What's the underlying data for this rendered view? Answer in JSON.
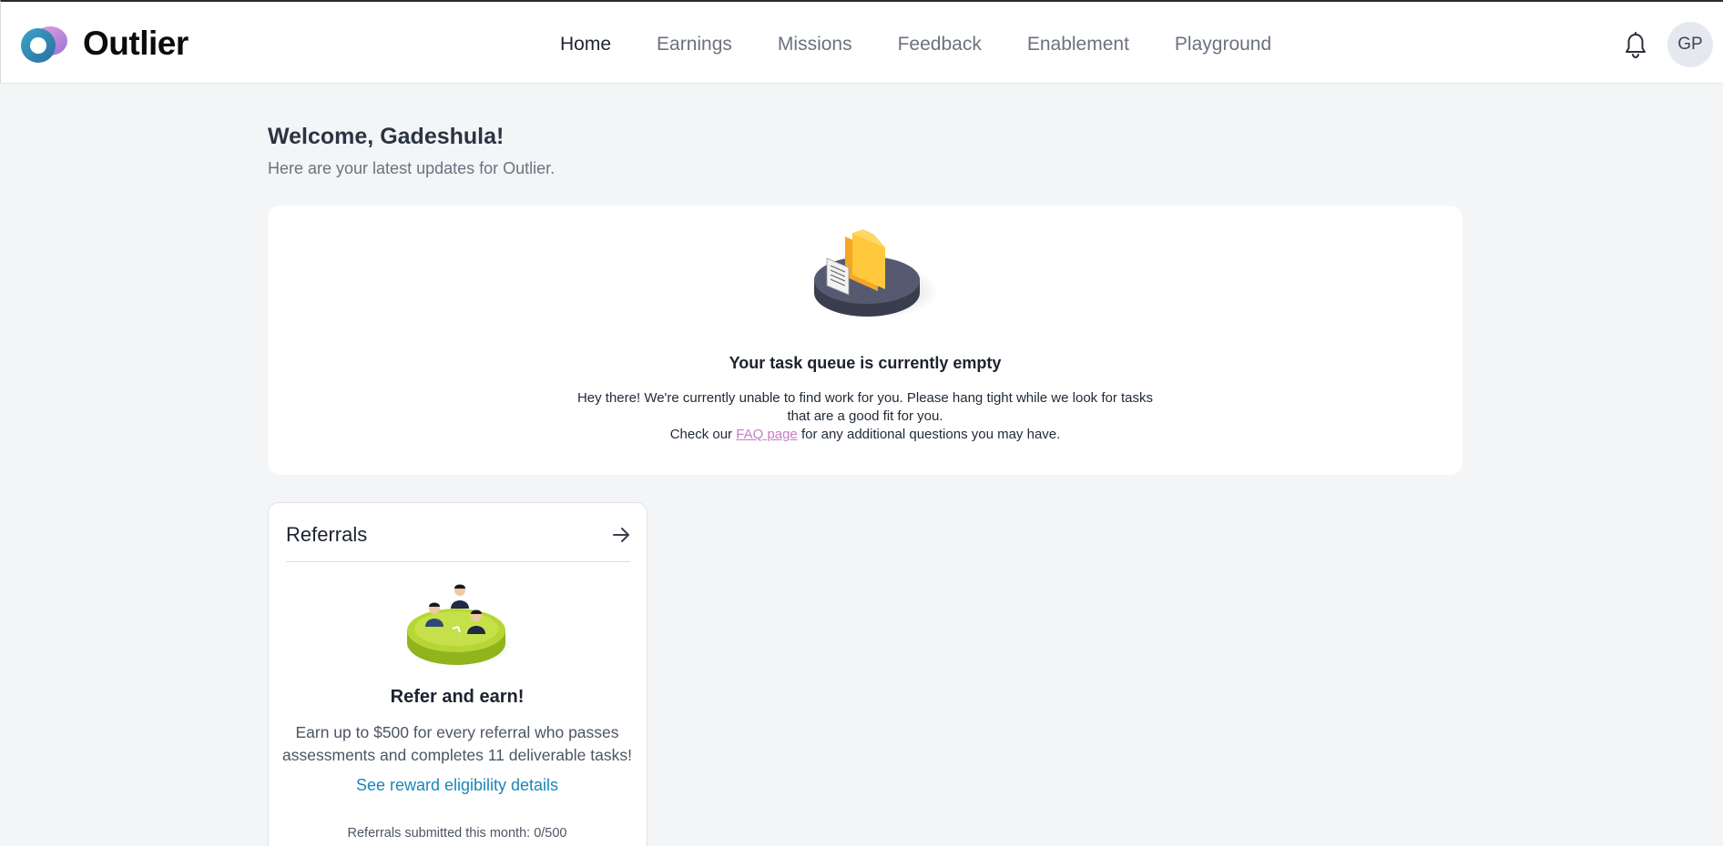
{
  "header": {
    "brand": "Outlier",
    "nav": [
      {
        "label": "Home",
        "active": true
      },
      {
        "label": "Earnings",
        "active": false
      },
      {
        "label": "Missions",
        "active": false
      },
      {
        "label": "Feedback",
        "active": false
      },
      {
        "label": "Enablement",
        "active": false
      },
      {
        "label": "Playground",
        "active": false
      }
    ],
    "notification_icon": "bell-icon",
    "avatar_initials": "GP"
  },
  "welcome": {
    "title": "Welcome, Gadeshula!",
    "subtitle": "Here are your latest updates for Outlier."
  },
  "task_queue": {
    "title": "Your task queue is currently empty",
    "line1": "Hey there! We're currently unable to find work for you. Please hang tight while we look for tasks that are a good fit for you.",
    "line2_prefix": "Check our",
    "faq_link": "FAQ page",
    "line2_suffix": "for any additional questions you may have."
  },
  "referrals": {
    "title": "Referrals",
    "heading": "Refer and earn!",
    "description": "Earn up to $500 for every referral who passes assessments and completes 11 deliverable tasks!",
    "link": "See reward eligibility details",
    "submitted": "Referrals submitted this month: 0/500",
    "arrow_icon": "arrow-right-icon"
  },
  "colors": {
    "background": "#f4f5f6",
    "link": "#1b86b8",
    "faq_link": "#c37ec6"
  }
}
